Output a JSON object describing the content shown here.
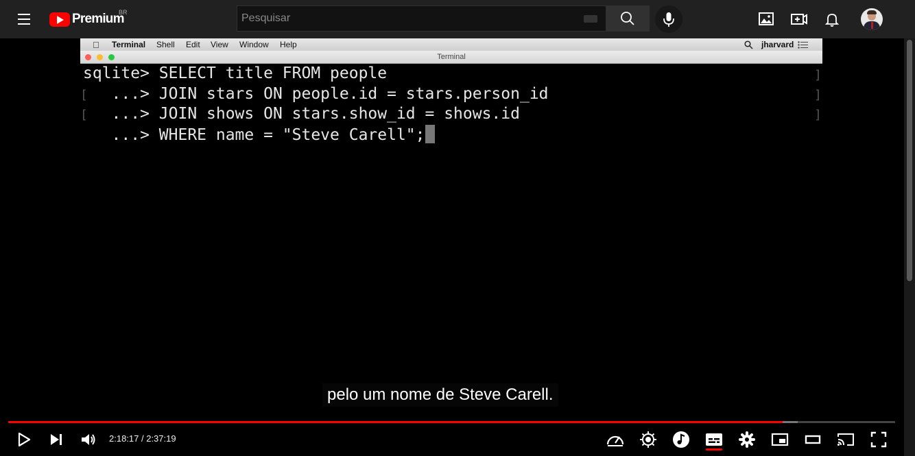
{
  "header": {
    "logo_text": "Premium",
    "country_code": "BR",
    "search_placeholder": "Pesquisar"
  },
  "icons": {
    "top": [
      "menu-icon",
      "search-icon",
      "mic-icon",
      "image-icon",
      "create-icon",
      "bell-icon"
    ],
    "player": [
      "play-icon",
      "next-icon",
      "volume-icon",
      "speed-icon",
      "brightness-icon",
      "music-icon",
      "subtitles-icon",
      "settings-icon",
      "miniplayer-icon",
      "theater-icon",
      "cast-icon",
      "fullscreen-icon"
    ]
  },
  "colors": {
    "accent": "#ff0000",
    "topbar_bg": "#212121",
    "terminal_bg": "#000000",
    "terminal_text": "#e6e6e6"
  },
  "video": {
    "mac_menubar": {
      "items": [
        "Terminal",
        "Shell",
        "Edit",
        "View",
        "Window",
        "Help"
      ],
      "user": "jharvard"
    },
    "terminal_title": "Terminal",
    "terminal_lines": [
      "sqlite> SELECT title FROM people",
      "   ...> JOIN stars ON people.id = stars.person_id",
      "   ...> JOIN shows ON stars.show_id = shows.id",
      "   ...> WHERE name = \"Steve Carell\";"
    ],
    "caption": "pelo um nome de Steve Carell."
  },
  "player": {
    "time_display": "2:18:17 / 2:37:19",
    "progress_fraction": 0.8728,
    "buffered_fraction": 0.89
  }
}
